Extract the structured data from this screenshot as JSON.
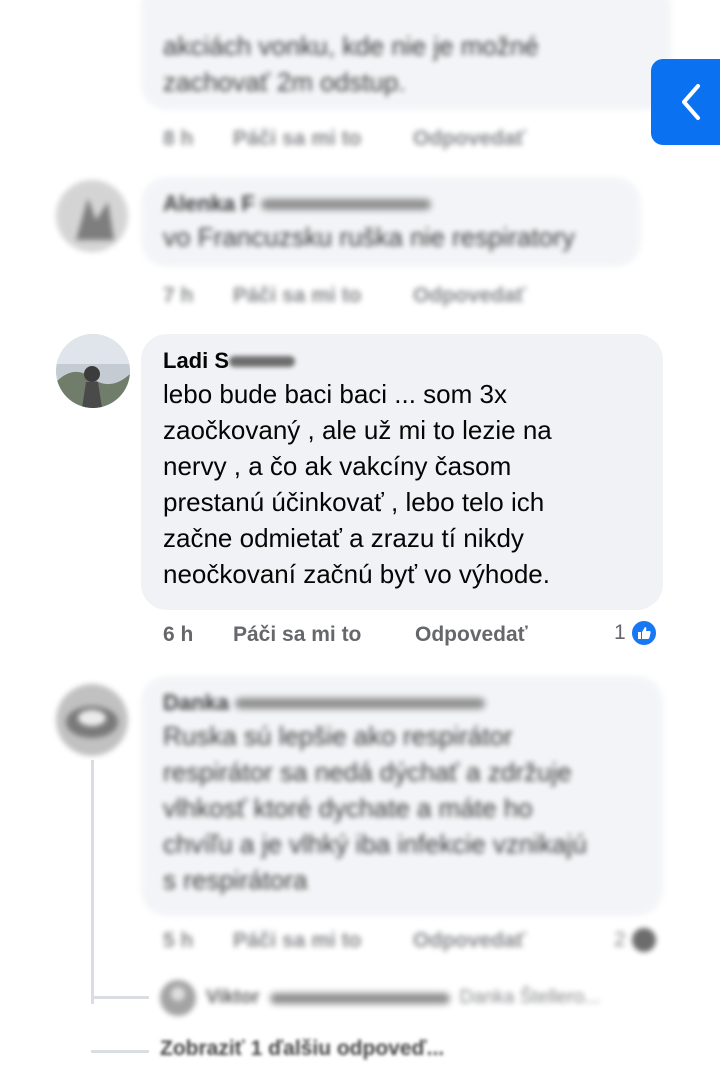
{
  "colors": {
    "bubble": "#f0f2f5",
    "secondary_text": "#65676b",
    "like_blue": "#1877f2",
    "back_button": "#0a72f0"
  },
  "back_button": {
    "icon": "chevron-left-icon"
  },
  "comments": [
    {
      "author": "",
      "text": "akciách vonku, kde nie je možné\nzachovať 2m odstup.",
      "time": "8 h",
      "like_label": "Páči sa mi to",
      "reply_label": "Odpovedať"
    },
    {
      "author": "Alenka F",
      "text": "vo Francuzsku ruška nie respiratory",
      "time": "7 h",
      "like_label": "Páči sa mi to",
      "reply_label": "Odpovedať"
    },
    {
      "author": "Ladi S",
      "text": "lebo bude baci baci ... som 3x\nzaočkovaný , ale už mi to lezie na\nnervy , a čo ak vakcíny časom\nprestanú účinkovať , lebo telo ich\nzačne odmietať a zrazu tí nikdy\nneočkovaní začnú byť vo výhode.",
      "time": "6 h",
      "like_label": "Páči sa mi to",
      "reply_label": "Odpovedať",
      "reaction_count": "1",
      "reaction_icon": "like-icon"
    },
    {
      "author": "Danka",
      "text": "Ruska sú lepšie ako respirátor\nrespirátor sa nedá dýchať a zdržuje\nvlhkosť ktoré dychate a máte ho\nchvíľu a je vlhký iba infekcie vznikajú\ns respirátora",
      "time": "5 h",
      "like_label": "Páči sa mi to",
      "reply_label": "Odpovedať",
      "reaction_count": "2",
      "reaction_icon": "reaction-icon"
    }
  ],
  "reply_preview": {
    "author": "Viktor",
    "mention": "Danka Štellero..."
  },
  "more_replies_label": "Zobraziť 1 ďalšiu odpoveď..."
}
